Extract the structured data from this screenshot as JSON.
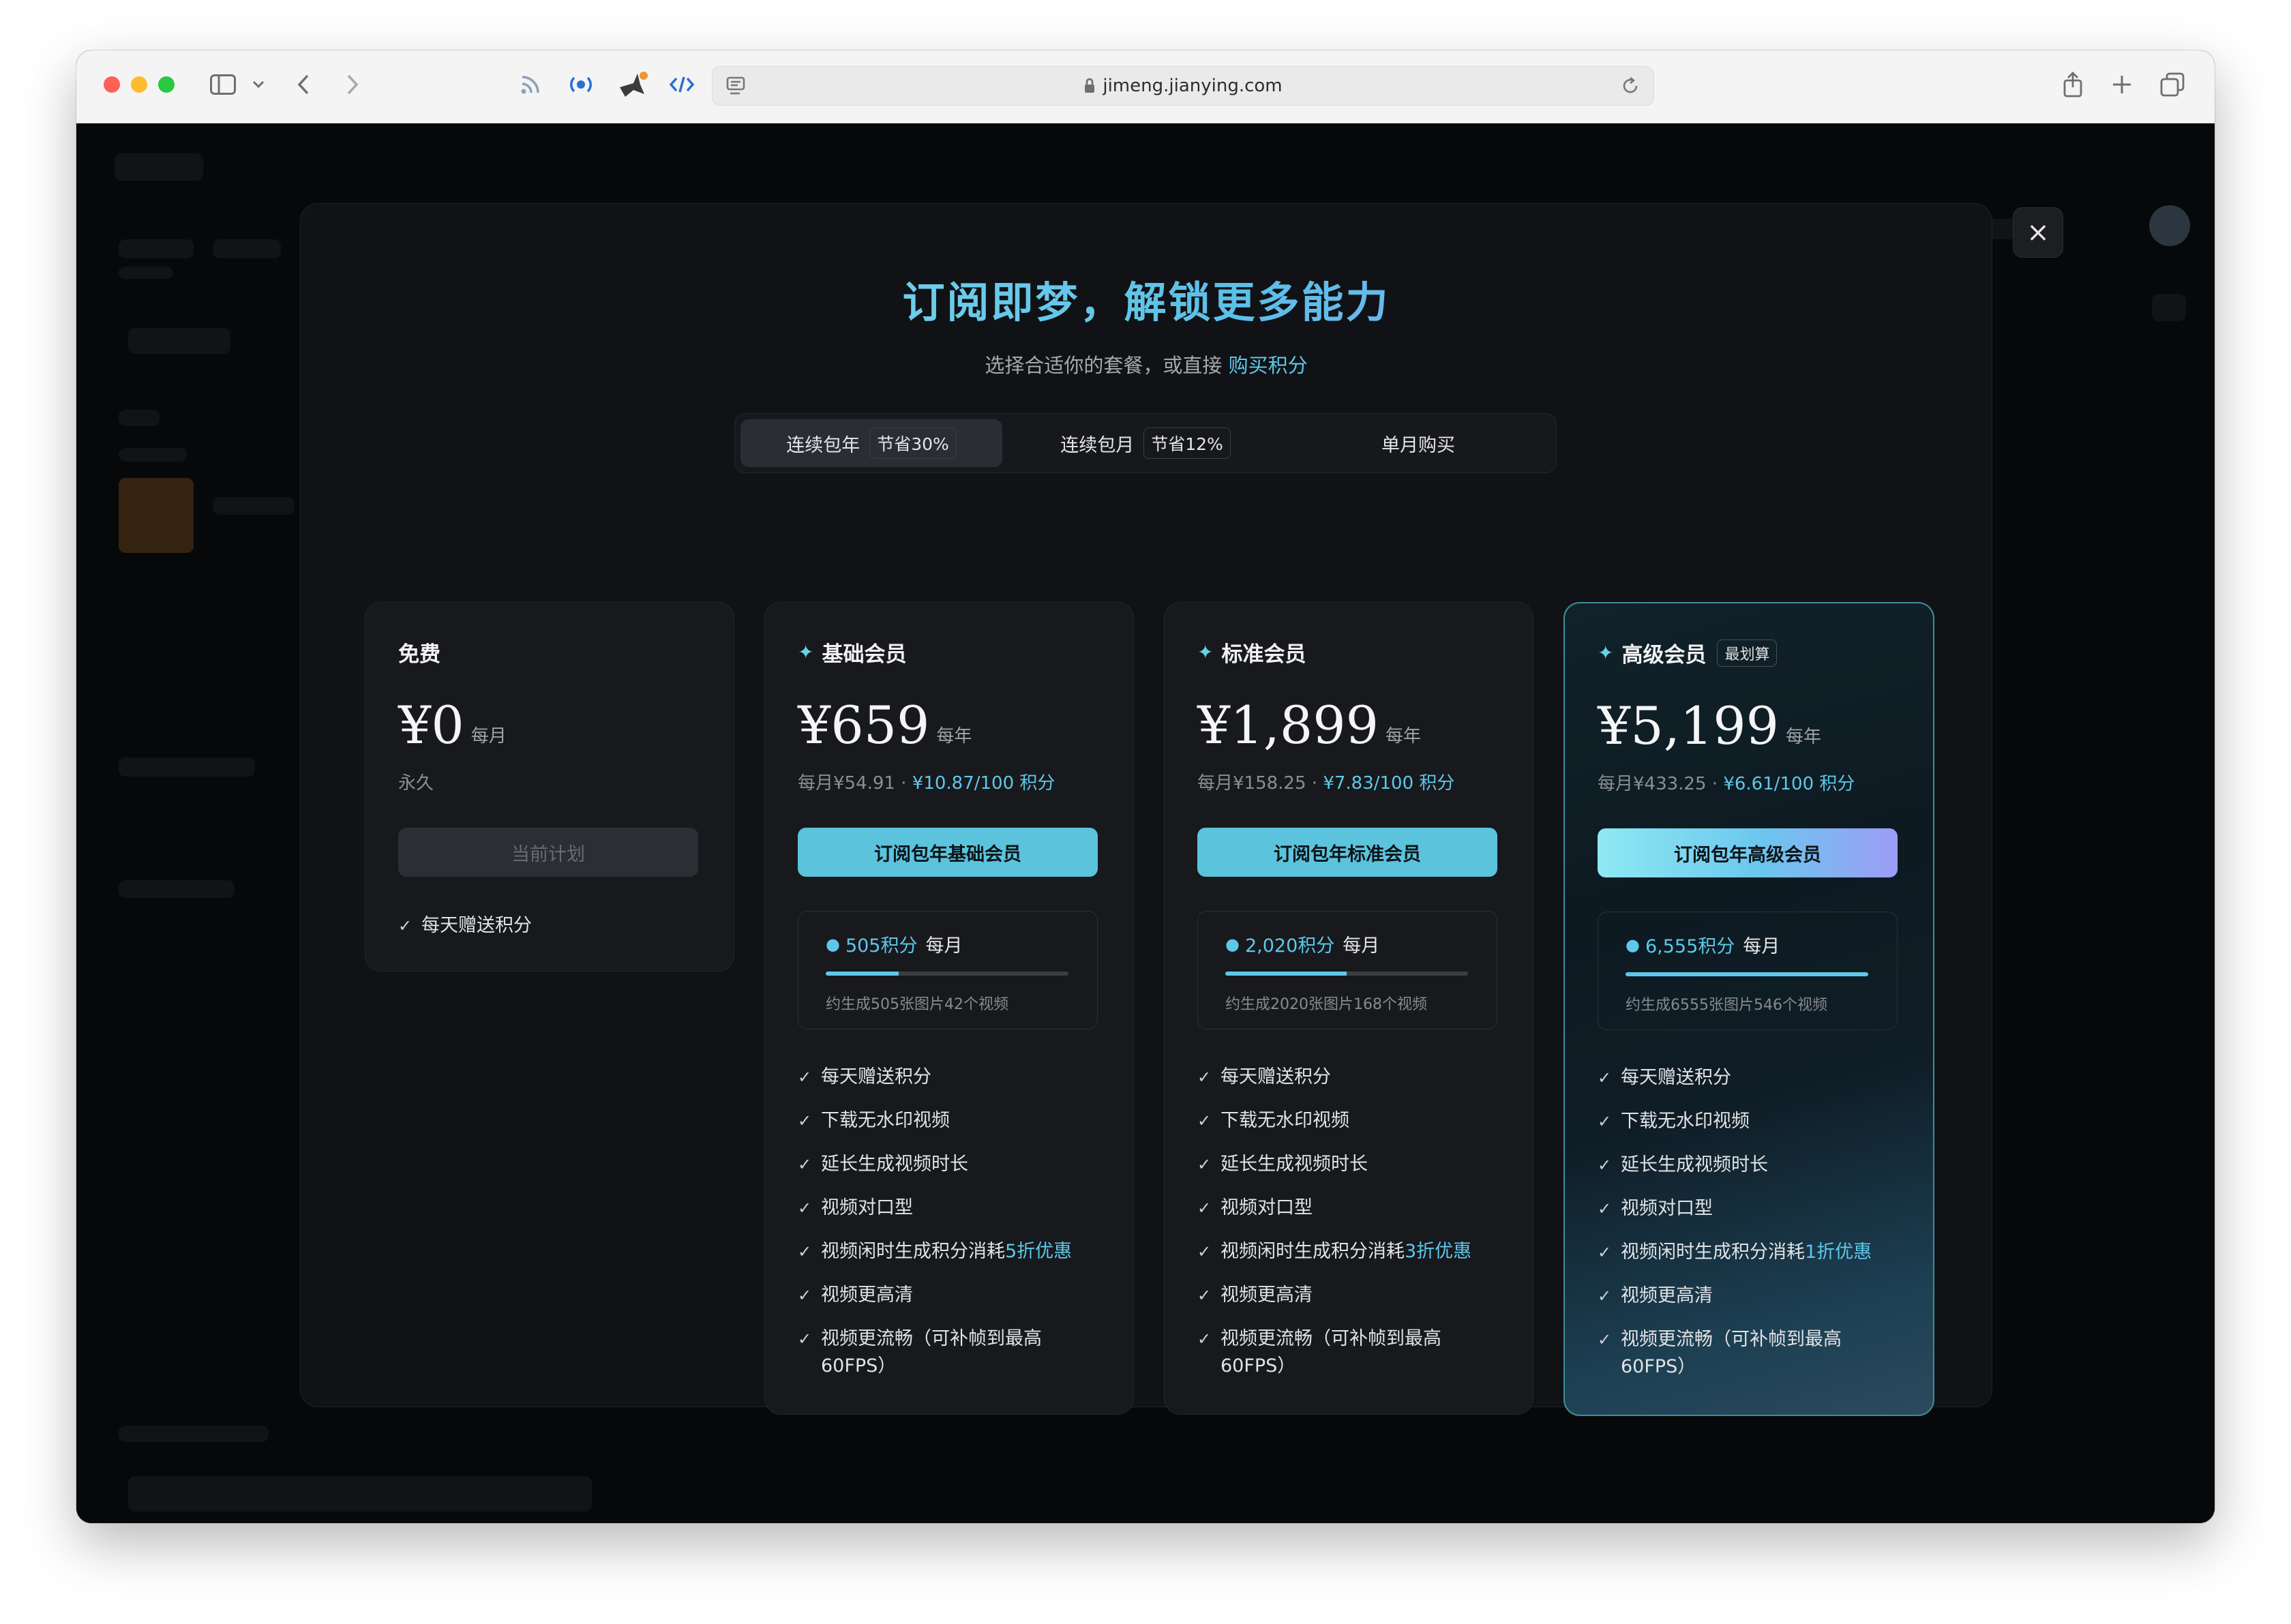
{
  "browser": {
    "url": "jimeng.jianying.com"
  },
  "modal": {
    "title": "订阅即梦，解锁更多能力",
    "subtitle_prefix": "选择合适你的套餐，或直接",
    "subtitle_link": "购买积分",
    "close_icon": "×"
  },
  "tabs": [
    {
      "label": "连续包年",
      "badge": "节省30%",
      "active": true
    },
    {
      "label": "连续包月",
      "badge": "节省12%",
      "active": false
    },
    {
      "label": "单月购买",
      "badge": "",
      "active": false
    }
  ],
  "plans": [
    {
      "name": "免费",
      "price": "¥0",
      "period": "每月",
      "subline_a": "永久",
      "subline_b": "",
      "button": "当前计划",
      "features": [
        "每天赠送积分"
      ]
    },
    {
      "name": "基础会员",
      "price": "¥659",
      "period": "每年",
      "subline_a": "每月¥54.91 · ",
      "subline_b": "¥10.87/100 积分",
      "button": "订阅包年基础会员",
      "credits_points": "505积分",
      "credits_period": "每月",
      "credits_fraction": 0.3,
      "credits_desc": "约生成505张图片42个视频",
      "features": [
        "每天赠送积分",
        "下载无水印视频",
        "延长生成视频时长",
        "视频对口型",
        {
          "pre": "视频闲时生成积分消耗",
          "hl": "5折优惠"
        },
        "视频更高清",
        "视频更流畅（可补帧到最高60FPS）"
      ]
    },
    {
      "name": "标准会员",
      "price": "¥1,899",
      "period": "每年",
      "subline_a": "每月¥158.25 · ",
      "subline_b": "¥7.83/100 积分",
      "button": "订阅包年标准会员",
      "credits_points": "2,020积分",
      "credits_period": "每月",
      "credits_fraction": 0.5,
      "credits_desc": "约生成2020张图片168个视频",
      "features": [
        "每天赠送积分",
        "下载无水印视频",
        "延长生成视频时长",
        "视频对口型",
        {
          "pre": "视频闲时生成积分消耗",
          "hl": "3折优惠"
        },
        "视频更高清",
        "视频更流畅（可补帧到最高60FPS）"
      ]
    },
    {
      "name": "高级会员",
      "tag": "最划算",
      "price": "¥5,199",
      "period": "每年",
      "subline_a": "每月¥433.25 · ",
      "subline_b": "¥6.61/100 积分",
      "button": "订阅包年高级会员",
      "credits_points": "6,555积分",
      "credits_period": "每月",
      "credits_fraction": 1.0,
      "credits_desc": "约生成6555张图片546个视频",
      "features": [
        "每天赠送积分",
        "下载无水印视频",
        "延长生成视频时长",
        "视频对口型",
        {
          "pre": "视频闲时生成积分消耗",
          "hl": "1折优惠"
        },
        "视频更高清",
        "视频更流畅（可补帧到最高60FPS）"
      ]
    }
  ],
  "colors": {
    "accent": "#5ec8ea",
    "background": "#111215",
    "card": "#17191d"
  }
}
